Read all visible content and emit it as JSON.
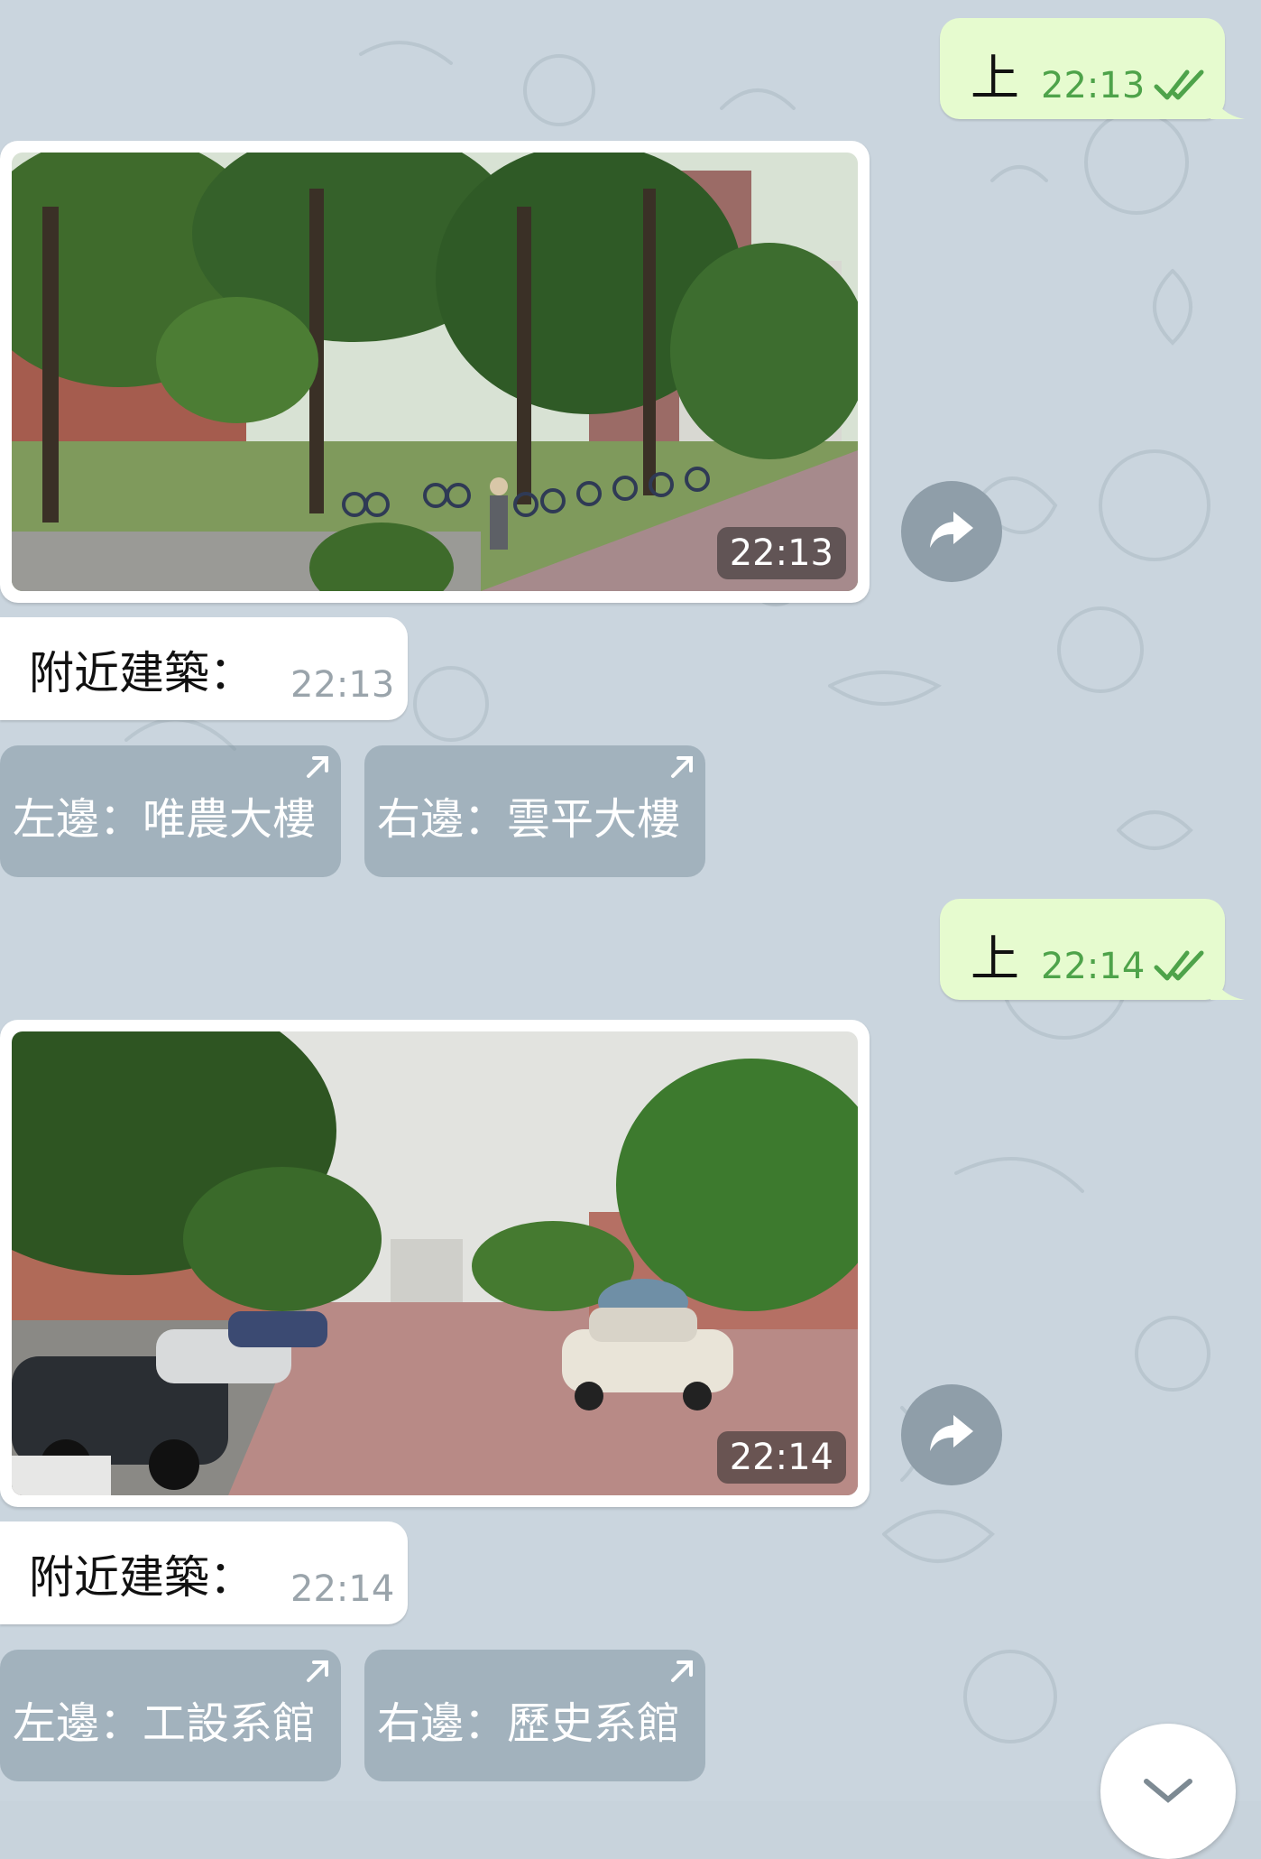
{
  "messages": {
    "m1": {
      "text": "上",
      "time": "22:13"
    },
    "m2": {
      "photo_time": "22:13"
    },
    "m3": {
      "text": "附近建築：",
      "time": "22:13"
    },
    "m3_buttons": {
      "left": "左邊：唯農大樓",
      "right": "右邊：雲平大樓"
    },
    "m4": {
      "text": "上",
      "time": "22:14"
    },
    "m5": {
      "photo_time": "22:14"
    },
    "m6": {
      "text": "附近建築：",
      "time": "22:14"
    },
    "m6_buttons": {
      "left": "左邊：工設系館",
      "right": "右邊：歷史系館"
    }
  },
  "icons": {
    "sent_status": "double-check-icon",
    "forward": "share-icon",
    "inline_button": "arrow-up-right-icon",
    "scroll_down": "chevron-down-icon"
  },
  "colors": {
    "outgoing_bubble": "#e6fbcf",
    "outgoing_time": "#4ea34a",
    "incoming_bubble": "#ffffff",
    "incoming_time": "#9aa4ab",
    "inline_button": "#8f9ea9"
  }
}
